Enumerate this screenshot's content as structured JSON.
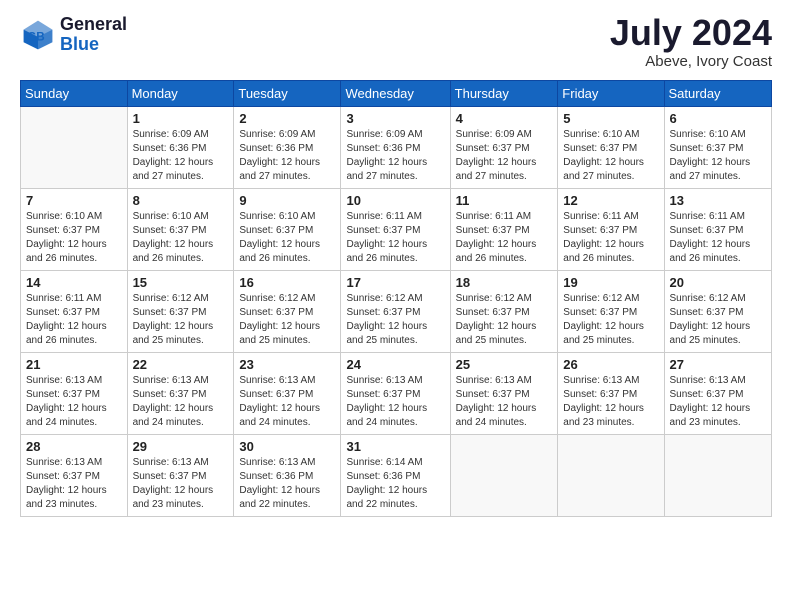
{
  "header": {
    "logo_line1": "General",
    "logo_line2": "Blue",
    "month_title": "July 2024",
    "location": "Abeve, Ivory Coast"
  },
  "weekdays": [
    "Sunday",
    "Monday",
    "Tuesday",
    "Wednesday",
    "Thursday",
    "Friday",
    "Saturday"
  ],
  "weeks": [
    [
      {
        "day": "",
        "info": ""
      },
      {
        "day": "1",
        "info": "Sunrise: 6:09 AM\nSunset: 6:36 PM\nDaylight: 12 hours\nand 27 minutes."
      },
      {
        "day": "2",
        "info": "Sunrise: 6:09 AM\nSunset: 6:36 PM\nDaylight: 12 hours\nand 27 minutes."
      },
      {
        "day": "3",
        "info": "Sunrise: 6:09 AM\nSunset: 6:36 PM\nDaylight: 12 hours\nand 27 minutes."
      },
      {
        "day": "4",
        "info": "Sunrise: 6:09 AM\nSunset: 6:37 PM\nDaylight: 12 hours\nand 27 minutes."
      },
      {
        "day": "5",
        "info": "Sunrise: 6:10 AM\nSunset: 6:37 PM\nDaylight: 12 hours\nand 27 minutes."
      },
      {
        "day": "6",
        "info": "Sunrise: 6:10 AM\nSunset: 6:37 PM\nDaylight: 12 hours\nand 27 minutes."
      }
    ],
    [
      {
        "day": "7",
        "info": "Sunrise: 6:10 AM\nSunset: 6:37 PM\nDaylight: 12 hours\nand 26 minutes."
      },
      {
        "day": "8",
        "info": "Sunrise: 6:10 AM\nSunset: 6:37 PM\nDaylight: 12 hours\nand 26 minutes."
      },
      {
        "day": "9",
        "info": "Sunrise: 6:10 AM\nSunset: 6:37 PM\nDaylight: 12 hours\nand 26 minutes."
      },
      {
        "day": "10",
        "info": "Sunrise: 6:11 AM\nSunset: 6:37 PM\nDaylight: 12 hours\nand 26 minutes."
      },
      {
        "day": "11",
        "info": "Sunrise: 6:11 AM\nSunset: 6:37 PM\nDaylight: 12 hours\nand 26 minutes."
      },
      {
        "day": "12",
        "info": "Sunrise: 6:11 AM\nSunset: 6:37 PM\nDaylight: 12 hours\nand 26 minutes."
      },
      {
        "day": "13",
        "info": "Sunrise: 6:11 AM\nSunset: 6:37 PM\nDaylight: 12 hours\nand 26 minutes."
      }
    ],
    [
      {
        "day": "14",
        "info": "Sunrise: 6:11 AM\nSunset: 6:37 PM\nDaylight: 12 hours\nand 26 minutes."
      },
      {
        "day": "15",
        "info": "Sunrise: 6:12 AM\nSunset: 6:37 PM\nDaylight: 12 hours\nand 25 minutes."
      },
      {
        "day": "16",
        "info": "Sunrise: 6:12 AM\nSunset: 6:37 PM\nDaylight: 12 hours\nand 25 minutes."
      },
      {
        "day": "17",
        "info": "Sunrise: 6:12 AM\nSunset: 6:37 PM\nDaylight: 12 hours\nand 25 minutes."
      },
      {
        "day": "18",
        "info": "Sunrise: 6:12 AM\nSunset: 6:37 PM\nDaylight: 12 hours\nand 25 minutes."
      },
      {
        "day": "19",
        "info": "Sunrise: 6:12 AM\nSunset: 6:37 PM\nDaylight: 12 hours\nand 25 minutes."
      },
      {
        "day": "20",
        "info": "Sunrise: 6:12 AM\nSunset: 6:37 PM\nDaylight: 12 hours\nand 25 minutes."
      }
    ],
    [
      {
        "day": "21",
        "info": "Sunrise: 6:13 AM\nSunset: 6:37 PM\nDaylight: 12 hours\nand 24 minutes."
      },
      {
        "day": "22",
        "info": "Sunrise: 6:13 AM\nSunset: 6:37 PM\nDaylight: 12 hours\nand 24 minutes."
      },
      {
        "day": "23",
        "info": "Sunrise: 6:13 AM\nSunset: 6:37 PM\nDaylight: 12 hours\nand 24 minutes."
      },
      {
        "day": "24",
        "info": "Sunrise: 6:13 AM\nSunset: 6:37 PM\nDaylight: 12 hours\nand 24 minutes."
      },
      {
        "day": "25",
        "info": "Sunrise: 6:13 AM\nSunset: 6:37 PM\nDaylight: 12 hours\nand 24 minutes."
      },
      {
        "day": "26",
        "info": "Sunrise: 6:13 AM\nSunset: 6:37 PM\nDaylight: 12 hours\nand 23 minutes."
      },
      {
        "day": "27",
        "info": "Sunrise: 6:13 AM\nSunset: 6:37 PM\nDaylight: 12 hours\nand 23 minutes."
      }
    ],
    [
      {
        "day": "28",
        "info": "Sunrise: 6:13 AM\nSunset: 6:37 PM\nDaylight: 12 hours\nand 23 minutes."
      },
      {
        "day": "29",
        "info": "Sunrise: 6:13 AM\nSunset: 6:37 PM\nDaylight: 12 hours\nand 23 minutes."
      },
      {
        "day": "30",
        "info": "Sunrise: 6:13 AM\nSunset: 6:36 PM\nDaylight: 12 hours\nand 22 minutes."
      },
      {
        "day": "31",
        "info": "Sunrise: 6:14 AM\nSunset: 6:36 PM\nDaylight: 12 hours\nand 22 minutes."
      },
      {
        "day": "",
        "info": ""
      },
      {
        "day": "",
        "info": ""
      },
      {
        "day": "",
        "info": ""
      }
    ]
  ]
}
